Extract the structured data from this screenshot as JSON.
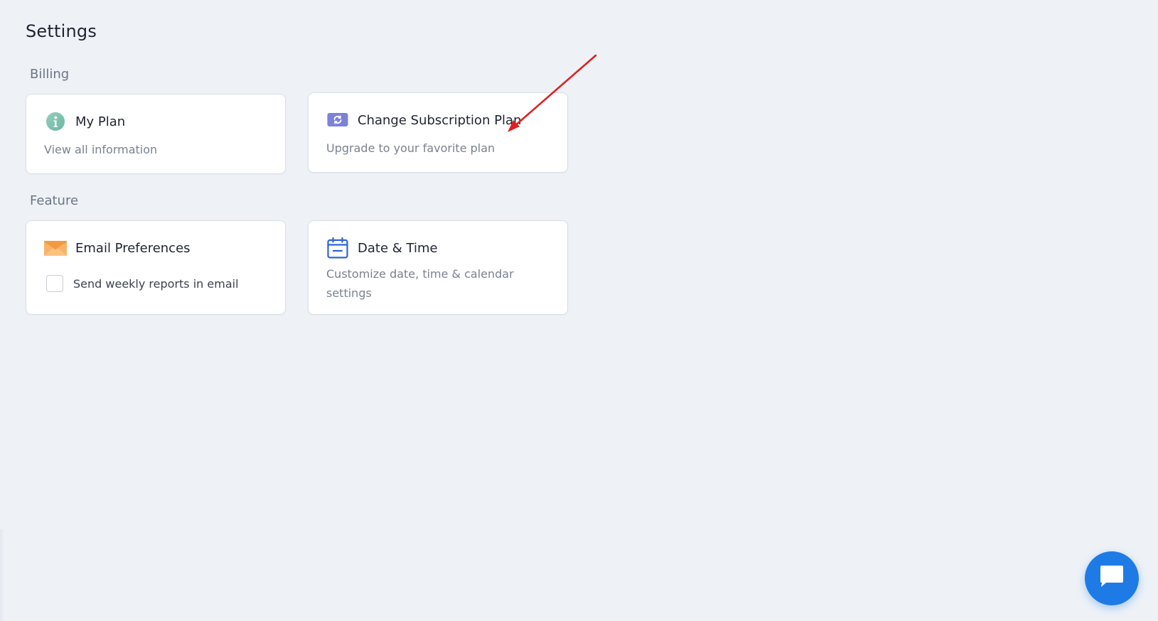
{
  "page": {
    "title": "Settings"
  },
  "sections": {
    "billing": {
      "title": "Billing",
      "cards": {
        "my_plan": {
          "title": "My Plan",
          "description": "View all information",
          "icon": "info-icon"
        },
        "change_subscription": {
          "title": "Change Subscription Plan",
          "description": "Upgrade to your favorite plan",
          "icon": "refresh-card-icon"
        }
      }
    },
    "feature": {
      "title": "Feature",
      "cards": {
        "email_preferences": {
          "title": "Email Preferences",
          "checkbox_label": "Send weekly reports in email",
          "checkbox_checked": false,
          "icon": "envelope-icon"
        },
        "date_time": {
          "title": "Date & Time",
          "description": "Customize date, time & calendar settings",
          "icon": "calendar-icon"
        }
      }
    }
  },
  "chat": {
    "icon": "chat-bubble-icon"
  },
  "colors": {
    "background": "#eef2f7",
    "card_border": "#d9dee6",
    "info_icon": "#7fc2b0",
    "subscription_icon": "#7b82d8",
    "envelope_icon": "#f6a44c",
    "calendar_icon": "#2f63d6",
    "chat_button": "#1e7be6",
    "annotation_arrow": "#e02020"
  }
}
